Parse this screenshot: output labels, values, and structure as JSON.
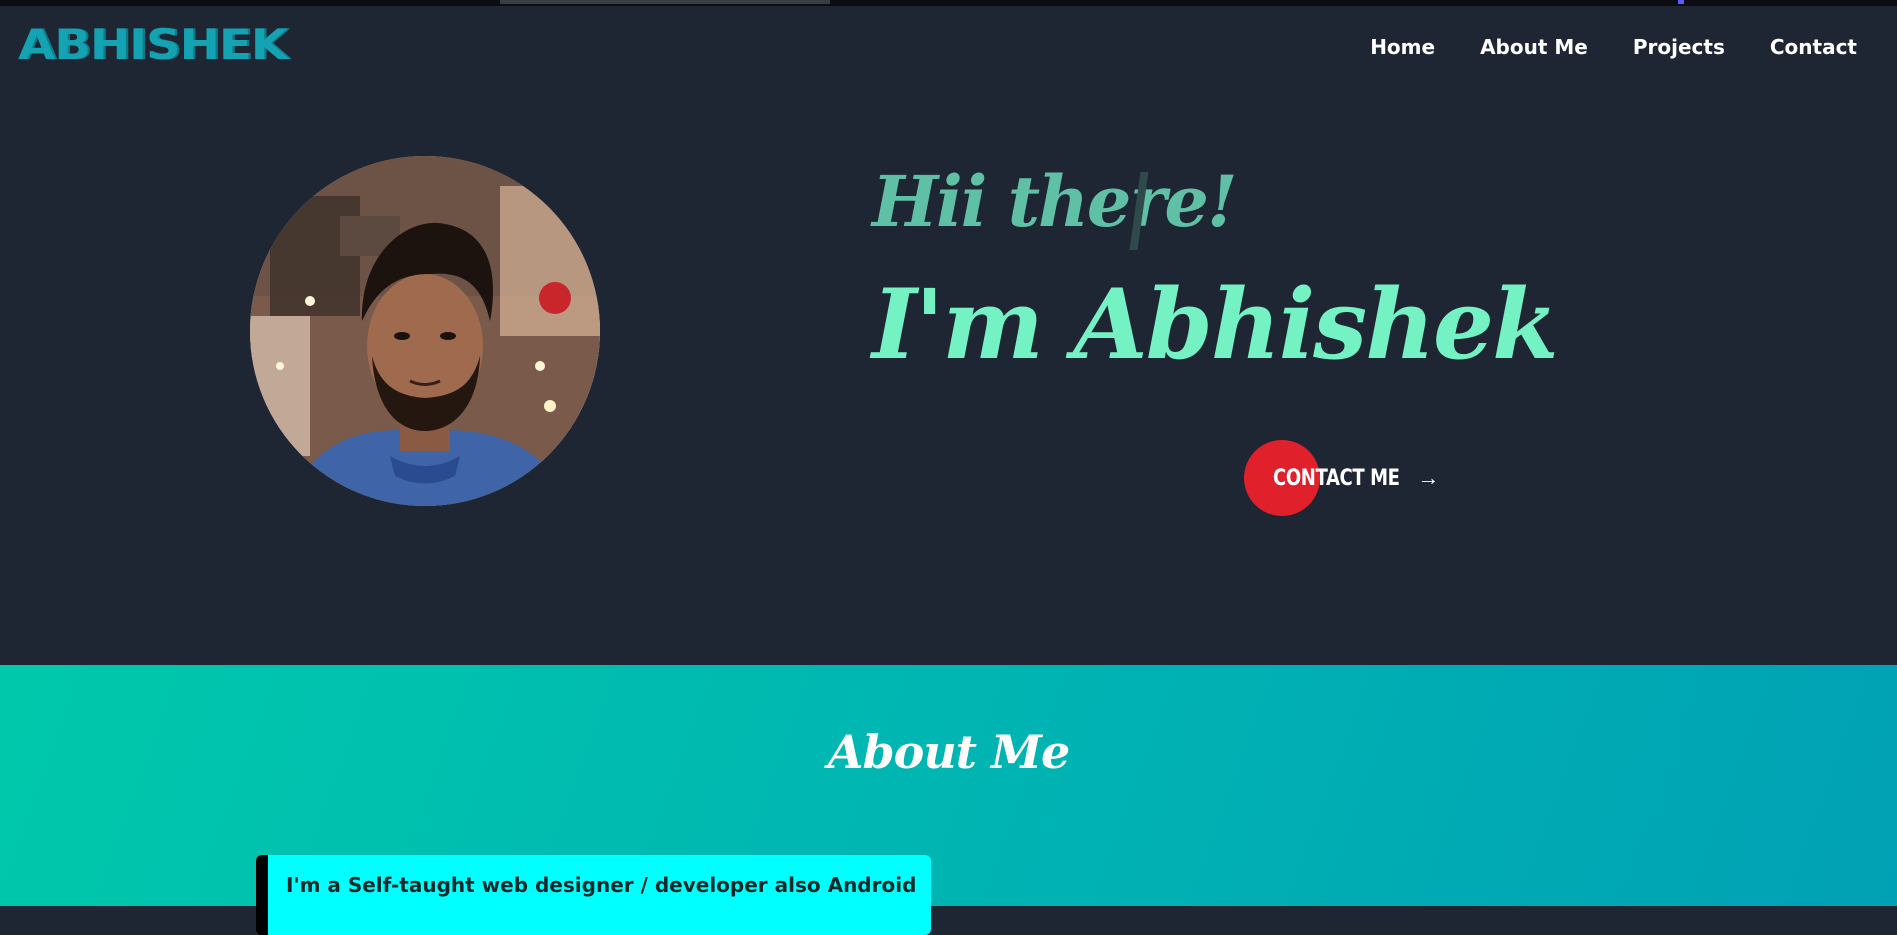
{
  "header": {
    "logo_text": "ABHISHEK",
    "nav": [
      {
        "label": "Home"
      },
      {
        "label": "About Me"
      },
      {
        "label": "Projects"
      },
      {
        "label": "Contact"
      }
    ]
  },
  "hero": {
    "greeting": "Hii there!",
    "name": "I'm  Abhishek",
    "contact_button_label": "CONTACT ME",
    "contact_button_arrow": "→",
    "avatar_icon": "profile-photo"
  },
  "about": {
    "title": "About Me",
    "card_text": "I'm a Self-taught web designer / developer also Android"
  },
  "colors": {
    "background": "#1f2633",
    "logo": "#13a3b2",
    "greeting": "#5fc0a5",
    "name": "#74f2c4",
    "contact_dot": "#e0202a",
    "about_gradient_start": "#00c9ab",
    "about_gradient_end": "#00a1b4",
    "card_bg": "#00ffff"
  }
}
